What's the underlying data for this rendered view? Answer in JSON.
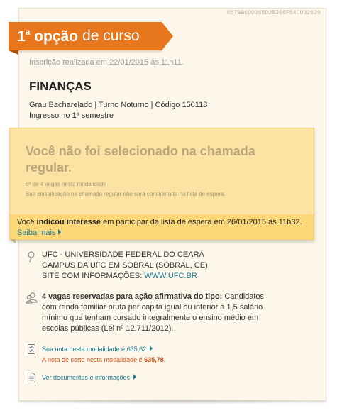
{
  "hash": "857BB6DD365D25366F54CDB2620",
  "ribbon": {
    "option_number": "1",
    "option_sup": "a",
    "option_word": "opção",
    "rest": "de curso"
  },
  "inscricao": "Inscrição realizada em 22/01/2015 às 11h11.",
  "course": {
    "title": "FINANÇAS",
    "meta_line1": "Grau Bacharelado | Turno Noturno | Código 150118",
    "meta_line2": "Ingresso no 1º semestre"
  },
  "status": {
    "title": "Você não foi selecionado na chamada regular.",
    "sub_line1": "6º de 4 vagas nesta modalidade",
    "sub_line2": "Sua classificação na chamada regular não será considerada na lista de espera.",
    "wait_pre": "Você ",
    "wait_bold": "indicou interesse",
    "wait_post": " em participar da lista de espera em 26/01/2015 às 11h32.",
    "saiba_mais": "Saiba mais"
  },
  "university": {
    "line1": "UFC - UNIVERSIDADE FEDERAL DO CEARÁ",
    "line2": "CAMPUS DA UFC EM SOBRAL (SOBRAL, CE)",
    "site_label": "SITE COM INFORMAÇÕES: ",
    "site_url": "WWW.UFC.BR"
  },
  "vagas": {
    "bold": "4 vagas reservadas para ação afirmativa do tipo:",
    "text": " Candidatos com renda familiar bruta per capita igual ou inferior a 1,5 salário mínimo que tenham cursado integralmente o ensino médio em escolas públicas (Lei nº 12.711/2012)."
  },
  "nota": {
    "link": "Sua nota nesta modalidade é 635,62",
    "corte_pre": "A nota de corte nesta modalidade é ",
    "corte_value": "635,78",
    "corte_post": "."
  },
  "docs_link": "Ver documentos e informações",
  "colors": {
    "ribbon": "#e8761c",
    "status_bg": "#fde3a3",
    "status_bar": "#fcd778",
    "link": "#1a7a94",
    "corte": "#cc4b10"
  },
  "icons": [
    "pin-icon",
    "people-icon",
    "checklist-icon",
    "document-icon"
  ]
}
